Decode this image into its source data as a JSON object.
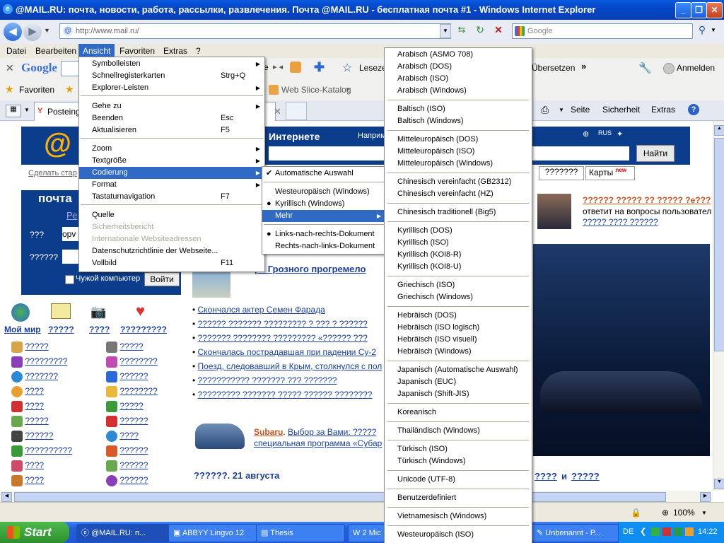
{
  "window": {
    "title": "@MAIL.RU: почта, новости, работа, рассылки, развлечения. Почта @MAIL.RU - бесплатная почта #1 - Windows Internet Explorer",
    "url": "http://www.mail.ru/",
    "search_placeholder": "Google"
  },
  "menubar": {
    "items": [
      "Datei",
      "Bearbeiten",
      "Ansicht",
      "Favoriten",
      "Extras",
      "?"
    ]
  },
  "google_toolbar": {
    "brand": "Google",
    "items": [
      "Lesezei",
      "Übersetzen",
      "Anmelden"
    ]
  },
  "fav_toolbar": {
    "favorites": "Favoriten",
    "web_slice": "Web Slice-Katalog",
    "tab_label": "Posteinga"
  },
  "command_bar": {
    "items": [
      "Seite",
      "Sicherheit",
      "Extras"
    ]
  },
  "ansicht_menu": {
    "items": [
      {
        "label": "Symbolleisten",
        "shortcut": "",
        "submenu": true
      },
      {
        "label": "Schnellregisterkarten",
        "shortcut": "Strg+Q"
      },
      {
        "label": "Explorer-Leisten",
        "shortcut": "",
        "submenu": true
      },
      {
        "label": "Gehe zu",
        "shortcut": "",
        "submenu": true
      },
      {
        "label": "Beenden",
        "shortcut": "Esc"
      },
      {
        "label": "Aktualisieren",
        "shortcut": "F5"
      },
      {
        "label": "Zoom",
        "shortcut": "",
        "submenu": true
      },
      {
        "label": "Textgröße",
        "shortcut": "",
        "submenu": true
      },
      {
        "label": "Codierung",
        "shortcut": "",
        "submenu": true
      },
      {
        "label": "Format",
        "shortcut": "",
        "submenu": true
      },
      {
        "label": "Tastaturnavigation",
        "shortcut": "F7"
      },
      {
        "label": "Quelle",
        "shortcut": ""
      },
      {
        "label": "Sicherheitsbericht",
        "shortcut": ""
      },
      {
        "label": "Internationale Websiteadressen",
        "shortcut": ""
      },
      {
        "label": "Datenschutzrichtlinie der Webseite...",
        "shortcut": ""
      },
      {
        "label": "Vollbild",
        "shortcut": "F11"
      }
    ]
  },
  "codierung_menu": {
    "items": [
      {
        "label": "Automatische Auswahl",
        "mark": "check"
      },
      {
        "label": "Westeuropäisch (Windows)",
        "mark": ""
      },
      {
        "label": "Kyrillisch (Windows)",
        "mark": "dot"
      },
      {
        "label": "Mehr",
        "mark": ""
      },
      {
        "label": "Links-nach-rechts-Dokument",
        "mark": "dot"
      },
      {
        "label": "Rechts-nach-links-Dokument",
        "mark": ""
      }
    ]
  },
  "mehr_menu": {
    "items": [
      "Arabisch (ASMO 708)",
      "Arabisch (DOS)",
      "Arabisch (ISO)",
      "Arabisch (Windows)",
      "Baltisch (ISO)",
      "Baltisch (Windows)",
      "Mitteleuropäisch (DOS)",
      "Mitteleuropäisch (ISO)",
      "Mitteleuropäisch (Windows)",
      "Chinesisch vereinfacht (GB2312)",
      "Chinesisch vereinfacht (HZ)",
      "Chinesisch traditionell  (Big5)",
      "Kyrillisch (DOS)",
      "Kyrillisch (ISO)",
      "Kyrillisch (KOI8-R)",
      "Kyrillisch (KOI8-U)",
      "Griechisch (ISO)",
      "Griechisch (Windows)",
      "Hebräisch (DOS)",
      "Hebräisch (ISO logisch)",
      "Hebräisch (ISO visuell)",
      "Hebräisch (Windows)",
      "Japanisch (Automatische Auswahl)",
      "Japanisch (EUC)",
      "Japanisch (Shift-JIS)",
      "Koreanisch",
      "Thailändisch (Windows)",
      "Türkisch (ISO)",
      "Türkisch (Windows)",
      "Unicode (UTF-8)",
      "Benutzerdefiniert",
      "Vietnamesisch (Windows)",
      "Westeuropäisch (ISO)"
    ]
  },
  "page": {
    "header_text": "Интернете",
    "header_link": "Наприм",
    "search_button": "Найти",
    "make_start": "Сделать стар",
    "pochta_title": "почта",
    "reg_link": "Ре",
    "login_label": "???",
    "login_value": "opv",
    "password_label": "??????",
    "remember_label": "Чужой компьютер",
    "login_button": "Войти",
    "tabs_right": [
      "???????",
      "Карты"
    ],
    "new_badge": "new",
    "news_top_title": "?????? ????? ?? ????? ?е???",
    "news_top_text": "ответит на вопросы пользовател",
    "news_top_link": "????? ???? ??????",
    "headline": "ре Грозного прогремело",
    "news_items": [
      "Скончался актер Семен Фарада",
      "?????? ??????? ????????? ? ??? ? ??????",
      "??????? ???????? ????????? «?????? ???",
      "Скончалась пострадавшая при падении Су-2",
      "Поезд, следовавший в Крым, столкнулся с пол",
      "??????????? ??????? ??? ???????",
      "????????? ??????? ????? ?????? ????????"
    ],
    "ad_brand": "Subaru",
    "ad_text": "Выбор за Вами: ?????",
    "ad_text2": "специальная программа «Субар",
    "date_heading": "??????. 21 августа",
    "bottom_links": [
      "????",
      "и",
      "?????"
    ],
    "icons_row": [
      "Мой мир",
      "?????",
      "????",
      "?????????"
    ],
    "left_links_col1": [
      "?????",
      "?????????",
      "???????",
      "????",
      "????",
      "?????",
      "??????",
      "??????????",
      "????",
      "????"
    ],
    "left_links_col2": [
      "?????",
      "????????",
      "??????",
      "????????",
      "?????",
      "??????",
      "????",
      "??????",
      "??????",
      "??????"
    ]
  },
  "statusbar": {
    "zoom": "100%"
  },
  "taskbar": {
    "start": "Start",
    "tasks": [
      "@MAIL.RU: п...",
      "ABBYY Lingvo 12",
      "Thesis",
      "2 Mic",
      "Unbenannt - P..."
    ],
    "lang": "DE",
    "time": "14:22"
  }
}
